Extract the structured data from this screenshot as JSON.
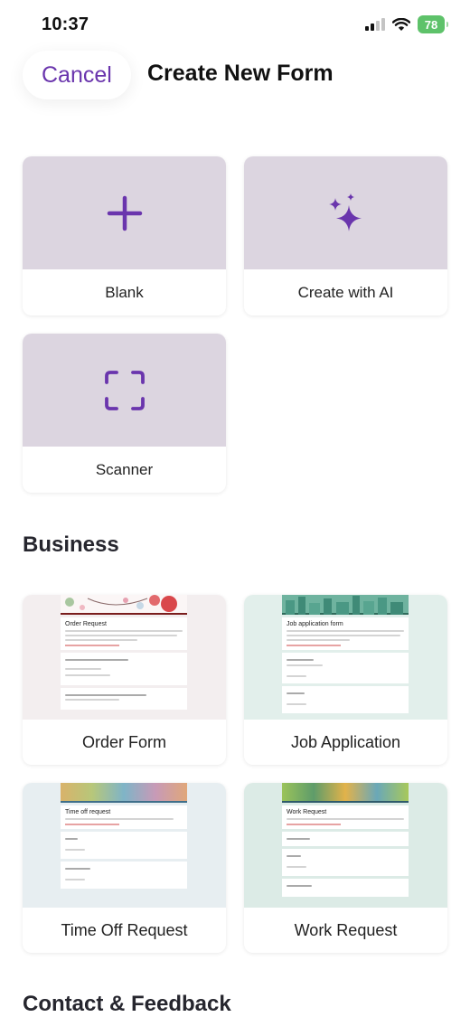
{
  "status": {
    "time": "10:37",
    "battery": "78"
  },
  "header": {
    "cancel_label": "Cancel",
    "title": "Create New Form"
  },
  "start_options": [
    {
      "label": "Blank",
      "icon": "plus-icon"
    },
    {
      "label": "Create with AI",
      "icon": "sparkle-icon"
    },
    {
      "label": "Scanner",
      "icon": "scan-icon"
    }
  ],
  "sections": {
    "business": "Business",
    "contact": "Contact & Feedback"
  },
  "templates": [
    {
      "label": "Order Form",
      "doc_title": "Order Request"
    },
    {
      "label": "Job Application",
      "doc_title": "Job application form"
    },
    {
      "label": "Time Off Request",
      "doc_title": "Time off request"
    },
    {
      "label": "Work Request",
      "doc_title": "Work Request"
    }
  ],
  "colors": {
    "accent": "#6a35ad",
    "tile": "#dcd5e0",
    "battery": "#5ec26a"
  }
}
